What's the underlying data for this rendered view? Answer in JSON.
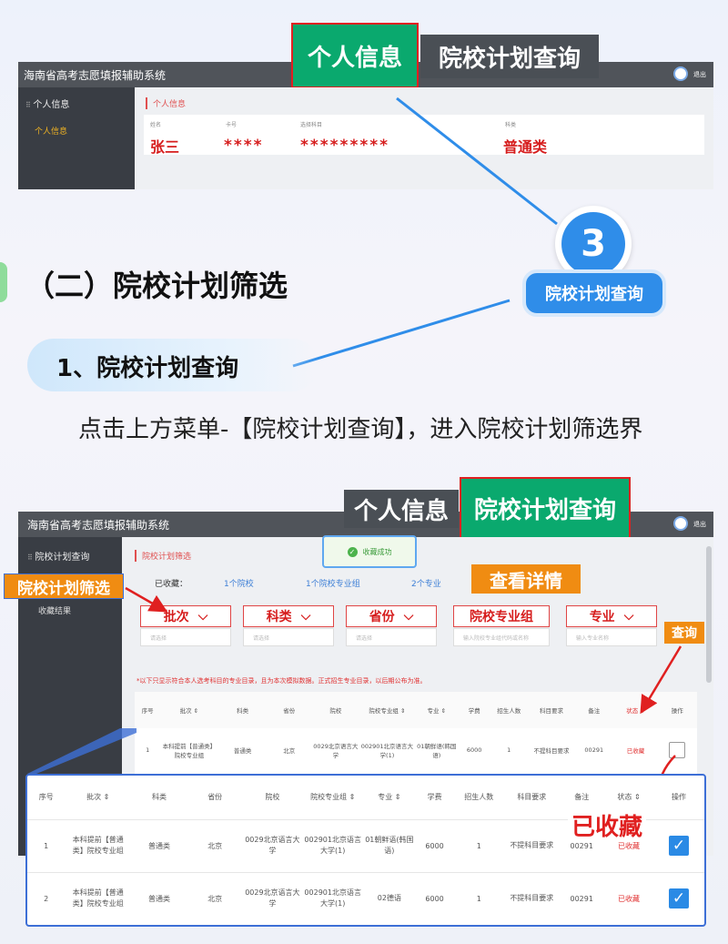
{
  "colors": {
    "accent_green": "#0aa96e",
    "accent_red": "#d61d1d",
    "bubble_blue": "#2f8de9",
    "orange": "#f08c12",
    "dark_bar": "#50545a",
    "sidebar": "#393d44"
  },
  "shot1": {
    "app_title": "海南省高考志愿填报辅助系统",
    "tab_personal": "个人信息",
    "tab_plan": "院校计划查询",
    "logout": "退出",
    "sidebar_item": "个人信息",
    "sidebar_sub": "个人信息",
    "breadcrumb": "个人信息",
    "fields": [
      {
        "label": "姓名",
        "value": "张三"
      },
      {
        "label": "卡号",
        "value": "****"
      },
      {
        "label": "选择科目",
        "value": "*********"
      },
      {
        "label": "科类",
        "value": "普通类"
      }
    ]
  },
  "step": {
    "number": "3",
    "label": "院校计划查询"
  },
  "section": {
    "title": "（二）院校计划筛选",
    "sub": "1、院校计划查询",
    "desc": "点击上方菜单-【院校计划查询】，进入院校计划筛选界"
  },
  "shot2": {
    "app_title": "海南省高考志愿填报辅助系统",
    "tab_personal": "个人信息",
    "tab_plan": "院校计划查询",
    "logout": "退出",
    "sidebar_item": "院校计划查询",
    "sidebar_sub": "收藏结果",
    "breadcrumb": "院校计划筛选",
    "toast": "收藏成功",
    "collected_label": "已收藏：",
    "collected": [
      "1个院校",
      "1个院校专业组",
      "2个专业"
    ],
    "callout_filter": "院校计划筛选",
    "callout_detail": "查看详情",
    "callout_query": "查询",
    "filters": [
      {
        "label": "批次",
        "placeholder": "请选择"
      },
      {
        "label": "科类",
        "placeholder": "请选择"
      },
      {
        "label": "省份",
        "placeholder": "请选择"
      },
      {
        "label": "院校专业组",
        "placeholder": "输入院校专业组代码或名称"
      },
      {
        "label": "专业",
        "placeholder": "输入专业名称"
      }
    ],
    "notice": "*以下只显示符合本人选考科目的专业目录，且为本次模拟数据。正式招生专业目录，以后期公布为准。",
    "headers": [
      "序号",
      "批次 ⇕",
      "科类",
      "省份",
      "院校",
      "院校专业组 ⇕",
      "专业 ⇕",
      "学费",
      "招生人数",
      "科目要求",
      "备注",
      "状态 ⇕",
      "操作"
    ],
    "rows": [
      {
        "no": "1",
        "batch": "本科提前【普通类】院校专业组",
        "type": "普通类",
        "prov": "北京",
        "school": "0029北京语言大学",
        "group": "002901北京语言大学(1)",
        "major": "01朝鲜语(韩国语)",
        "fee": "6000",
        "count": "1",
        "req": "不提科目要求",
        "remark": "00291",
        "status": "已收藏"
      }
    ]
  },
  "zoom": {
    "callout_collected": "已收藏",
    "headers": [
      "序号",
      "批次 ⇕",
      "科类",
      "省份",
      "院校",
      "院校专业组 ⇕",
      "专业 ⇕",
      "学费",
      "招生人数",
      "科目要求",
      "备注",
      "状态 ⇕",
      "操作"
    ],
    "rows": [
      {
        "no": "1",
        "batch": "本科提前【普通类】院校专业组",
        "type": "普通类",
        "prov": "北京",
        "school": "0029北京语言大学",
        "group": "002901北京语言大学(1)",
        "major": "01朝鲜语(韩国语)",
        "fee": "6000",
        "count": "1",
        "req": "不提科目要求",
        "remark": "00291",
        "status": "已收藏"
      },
      {
        "no": "2",
        "batch": "本科提前【普通类】院校专业组",
        "type": "普通类",
        "prov": "北京",
        "school": "0029北京语言大学",
        "group": "002901北京语言大学(1)",
        "major": "02德语",
        "fee": "6000",
        "count": "1",
        "req": "不提科目要求",
        "remark": "00291",
        "status": "已收藏"
      }
    ]
  }
}
